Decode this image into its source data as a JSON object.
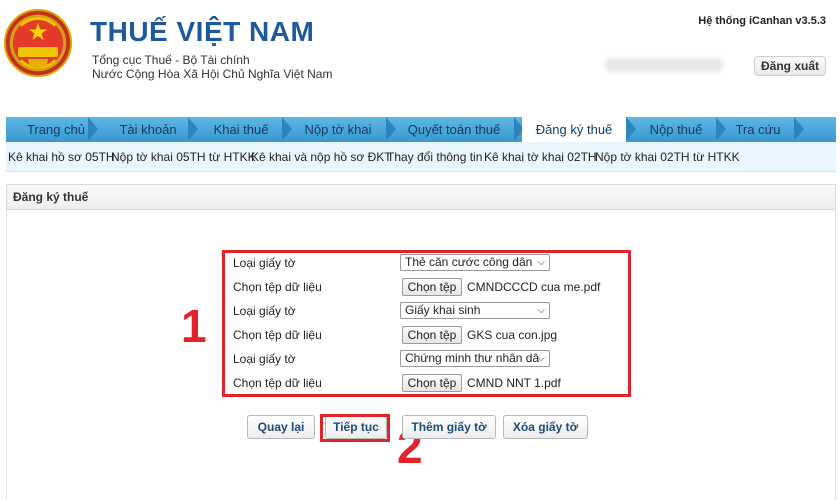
{
  "header": {
    "brand_title": "THUẾ VIỆT NAM",
    "brand_line1": "Tổng cục Thuế - Bộ Tài chính",
    "brand_line2": "Nước Cộng Hòa Xã Hội Chủ Nghĩa Việt Nam",
    "system_version": "Hệ thống iCanhan v3.5.3",
    "logout_label": "Đăng xuất",
    "logo_icon": "national-emblem-icon"
  },
  "nav": {
    "tabs": [
      {
        "label": "Trang chủ"
      },
      {
        "label": "Tài khoản"
      },
      {
        "label": "Khai thuế"
      },
      {
        "label": "Nộp tờ khai"
      },
      {
        "label": "Quyết toán thuế"
      },
      {
        "label": "Đăng ký thuế"
      },
      {
        "label": "Nộp thuế"
      },
      {
        "label": "Tra cứu"
      }
    ],
    "active_tab": "Đăng ký thuế"
  },
  "subnav": {
    "links": [
      "Kê khai hồ sơ 05TH",
      "Nộp tờ khai 05TH từ HTKK",
      "Kê khai và nộp hồ sơ ĐKT",
      "Thay đổi thông tin",
      "Kê khai tờ khai 02TH",
      "Nộp tờ khai 02TH từ HTKK"
    ]
  },
  "section": {
    "title": "Đăng ký thuế"
  },
  "form": {
    "rows": [
      {
        "label": "Loại giấy tờ",
        "kind": "select",
        "value": "Thẻ căn cước công dân"
      },
      {
        "label": "Chọn tệp dữ liệu",
        "kind": "file",
        "button": "Chọn tệp",
        "file": "CMNDCCCD cua me.pdf"
      },
      {
        "label": "Loại giấy tờ",
        "kind": "select",
        "value": "Giấy khai sinh"
      },
      {
        "label": "Chọn tệp dữ liệu",
        "kind": "file",
        "button": "Chọn tệp",
        "file": "GKS cua con.jpg"
      },
      {
        "label": "Loại giấy tờ",
        "kind": "select",
        "value": "Chứng minh thư nhân dâ"
      },
      {
        "label": "Chọn tệp dữ liệu",
        "kind": "file",
        "button": "Chọn tệp",
        "file": "CMND NNT 1.pdf"
      }
    ]
  },
  "annotations": {
    "one": "1",
    "two": "2"
  },
  "actions": {
    "back": "Quay lại",
    "continue": "Tiếp tục",
    "add_doc": "Thêm giấy tờ",
    "delete_doc": "Xóa giấy tờ"
  },
  "colors": {
    "brand": "#1e5a9a",
    "nav": "#3898cf",
    "highlight": "#e0242a"
  }
}
